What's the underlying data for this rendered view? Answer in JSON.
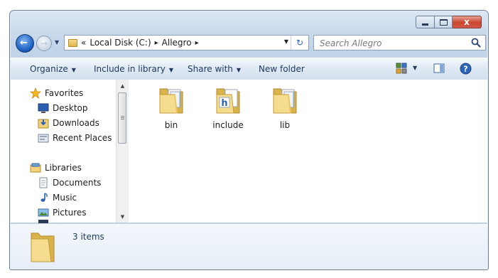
{
  "window": {
    "caption_buttons": [
      "minimize",
      "maximize",
      "close"
    ],
    "close_glyph": "x"
  },
  "nav": {
    "back_glyph": "←",
    "forward_glyph": "→"
  },
  "address": {
    "overflow": "«",
    "breadcrumb": [
      "Local Disk (C:)",
      "Allegro"
    ],
    "separator": "▸"
  },
  "search": {
    "placeholder": "Search Allegro"
  },
  "toolbar": {
    "organize": "Organize",
    "include_in_library": "Include in library",
    "share_with": "Share with",
    "new_folder": "New folder"
  },
  "nav_pane": {
    "favorites": {
      "label": "Favorites",
      "items": [
        "Desktop",
        "Downloads",
        "Recent Places"
      ]
    },
    "libraries": {
      "label": "Libraries",
      "items": [
        "Documents",
        "Music",
        "Pictures"
      ]
    }
  },
  "files": [
    {
      "name": "bin",
      "icon": "folder-icon"
    },
    {
      "name": "include",
      "icon": "folder-h-icon"
    },
    {
      "name": "lib",
      "icon": "folder-icon"
    }
  ],
  "details": {
    "count_text": "3 items"
  },
  "colors": {
    "toolbar_text": "#1e395b",
    "close_red": "#c8452d",
    "folder_yellow": "#f3da8e"
  }
}
